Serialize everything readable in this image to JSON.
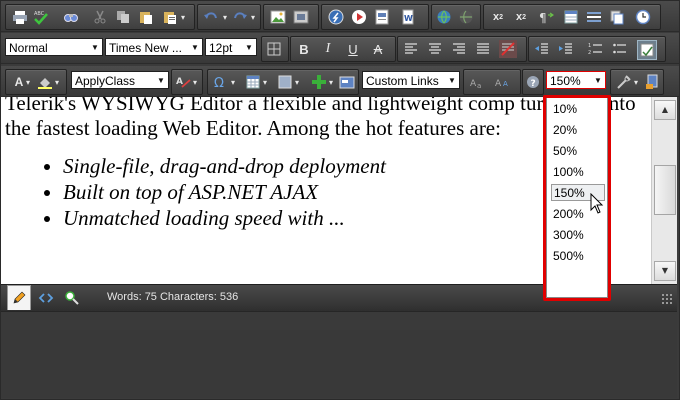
{
  "toolbar": {
    "paragraph_style": "Normal",
    "font_name": "Times New ...",
    "font_size": "12pt",
    "apply_class": "ApplyClass",
    "custom_links": "Custom Links",
    "zoom_value": "150%"
  },
  "editor": {
    "paragraph": "Telerik's WYSIWYG Editor a flexible and lightweight comp turning it into the fastest loading Web Editor. Among the hot features are:",
    "bullets": [
      "Single-file, drag-and-drop deployment",
      "Built on top of ASP.NET AJAX",
      "Unmatched loading speed with ..."
    ]
  },
  "statusbar": {
    "word_count_text": "Words: 75 Characters: 536"
  },
  "zoom_menu": {
    "options": [
      "10%",
      "20%",
      "50%",
      "100%",
      "150%",
      "200%",
      "300%",
      "500%"
    ],
    "selected": "150%"
  },
  "colors": {
    "toolbar_bg": "#3f3f3f",
    "highlight": "#e00000",
    "editor_bg": "#ffffff"
  },
  "icons": {
    "print": "print-icon",
    "spellcheck": "spellcheck-icon",
    "find": "find-icon",
    "cut": "cut-icon",
    "copy": "copy-icon",
    "paste": "paste-icon",
    "undo": "undo-icon",
    "redo": "redo-icon",
    "image": "image-icon",
    "flash": "flash-icon",
    "media": "media-icon",
    "document": "document-icon",
    "link": "link-icon",
    "unlink": "unlink-icon",
    "superscript": "superscript-icon",
    "subscript": "subscript-icon",
    "bold": "bold-icon",
    "italic": "italic-icon",
    "underline": "underline-icon",
    "strikethrough": "strikethrough-icon",
    "align_left": "align-left-icon",
    "align_center": "align-center-icon",
    "align_right": "align-right-icon",
    "justify": "justify-icon",
    "design_mode": "pencil-icon",
    "html_mode": "code-icon",
    "preview_mode": "zoom-icon"
  }
}
